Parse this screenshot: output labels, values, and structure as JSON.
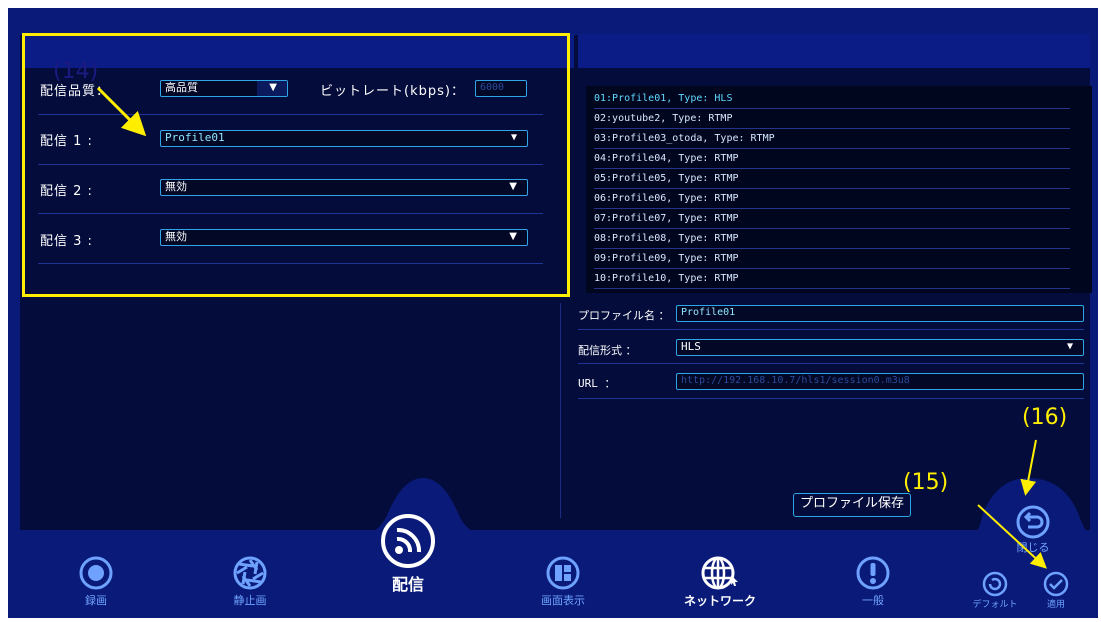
{
  "settings": {
    "quality_label": "配信品質：",
    "quality_value": "高品質",
    "bitrate_label": "ビットレート(kbps)：",
    "bitrate_value": "6000",
    "stream1_label": "配信 1 :",
    "stream1_value": "Profile01",
    "stream2_label": "配信 2 :",
    "stream2_value": "無効",
    "stream3_label": "配信 3 :",
    "stream3_value": "無効"
  },
  "profiles": [
    "01:Profile01, Type: HLS",
    "02:youtube2, Type: RTMP",
    "03:Profile03_otoda, Type: RTMP",
    "04:Profile04, Type: RTMP",
    "05:Profile05, Type: RTMP",
    "06:Profile06, Type: RTMP",
    "07:Profile07, Type: RTMP",
    "08:Profile08, Type: RTMP",
    "09:Profile09, Type: RTMP",
    "10:Profile10, Type: RTMP"
  ],
  "profile_editor": {
    "name_label": "プロファイル名 ：",
    "name_value": "Profile01",
    "format_label": "配信形式 ：",
    "format_value": "HLS",
    "url_label": "URL ：",
    "url_value": "http://192.168.10.7/hls1/session0.m3u8",
    "save_label": "プロファイル保存"
  },
  "nav": {
    "record": "録画",
    "still": "静止画",
    "stream": "配信",
    "display": "画面表示",
    "network": "ネットワーク",
    "general": "一般",
    "close": "閉じる",
    "default": "デフォルト",
    "apply": "適用"
  },
  "annotations": {
    "a14": "(14)",
    "a15": "(15)",
    "a16": "(16)"
  },
  "colors": {
    "background": "#0a1a78",
    "panel": "#040c3c",
    "accent": "#2fa6e8",
    "annotation": "#ffee00"
  }
}
